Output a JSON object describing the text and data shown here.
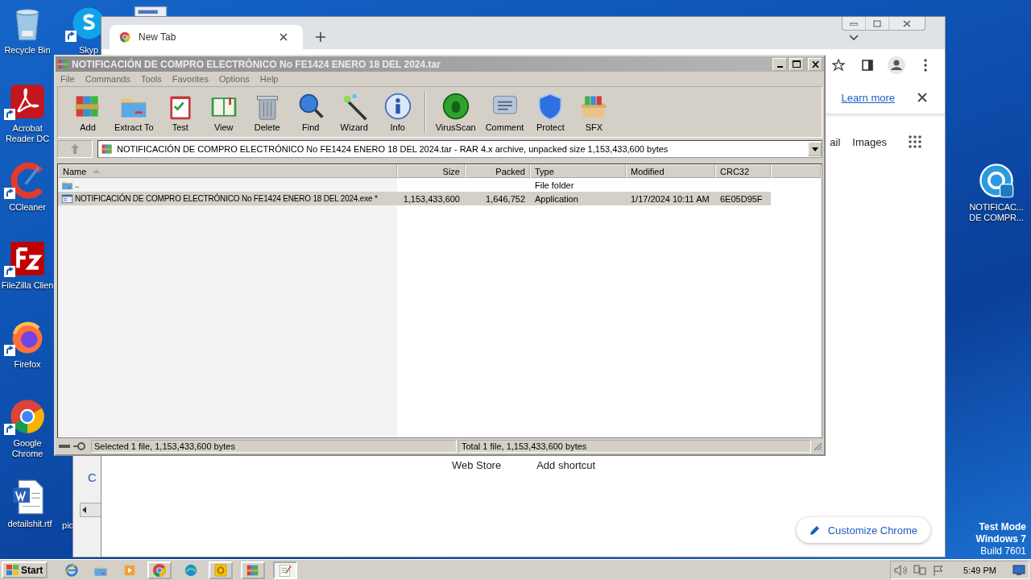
{
  "desktop": {
    "icons": [
      {
        "label": "Recycle Bin",
        "kind": "recycle",
        "shortcut": false
      },
      {
        "label": "Skyp",
        "kind": "skype",
        "shortcut": true
      },
      {
        "kind": "doc",
        "shortcut": false
      },
      {
        "label": "Acrobat Reader DC",
        "kind": "acrobat",
        "shortcut": true
      },
      {
        "label": "CCleaner",
        "kind": "ccleaner",
        "shortcut": true
      },
      {
        "label": "FileZilla Clien",
        "kind": "filezilla",
        "shortcut": true
      },
      {
        "label": "Firefox",
        "kind": "firefox",
        "shortcut": true
      },
      {
        "label": "Google Chrome",
        "kind": "chrome",
        "shortcut": true
      },
      {
        "label": "detailshit.rtf",
        "kind": "word",
        "shortcut": false
      },
      {
        "label": "pic",
        "shortcut": false
      },
      {
        "label": "NOTIFICAC... DE COMPR...",
        "kind": "app",
        "shortcut": false
      }
    ],
    "edition": [
      "Test Mode",
      "Windows 7",
      "Build 7601"
    ]
  },
  "back_window": {
    "text": "C"
  },
  "chrome": {
    "tab": {
      "title": "New Tab"
    },
    "banner": {
      "link": "Learn more"
    },
    "top_links": [
      "ail",
      "Images"
    ],
    "shortcuts": [
      "Web Store",
      "Add shortcut"
    ],
    "customize_button": "Customize Chrome"
  },
  "winrar": {
    "title": "NOTIFICACIÓN DE COMPRO ELECTRÓNICO No FE1424 ENERO 18 DEL 2024.tar",
    "menu": [
      "File",
      "Commands",
      "Tools",
      "Favorites",
      "Options",
      "Help"
    ],
    "toolbar": [
      {
        "label": "Add",
        "kind": "add",
        "separated": false
      },
      {
        "label": "Extract To",
        "kind": "extract",
        "separated": false
      },
      {
        "label": "Test",
        "kind": "test",
        "separated": false
      },
      {
        "label": "View",
        "kind": "view",
        "separated": false
      },
      {
        "label": "Delete",
        "kind": "delete",
        "separated": false
      },
      {
        "label": "Find",
        "kind": "find",
        "separated": false
      },
      {
        "label": "Wizard",
        "kind": "wizard",
        "separated": false
      },
      {
        "label": "Info",
        "kind": "info",
        "separated": false
      },
      {
        "label": "VirusScan",
        "kind": "virusscan",
        "separated": true
      },
      {
        "label": "Comment",
        "kind": "comment",
        "separated": false
      },
      {
        "label": "Protect",
        "kind": "protect",
        "separated": false
      },
      {
        "label": "SFX",
        "kind": "sfx",
        "separated": false
      }
    ],
    "address": "NOTIFICACIÓN DE COMPRO ELECTRÓNICO No FE1424 ENERO 18 DEL 2024.tar - RAR 4.x archive, unpacked size 1,153,433,600 bytes",
    "columns": [
      {
        "label": "Name",
        "sorted": true
      },
      {
        "label": "Size"
      },
      {
        "label": "Packed"
      },
      {
        "label": "Type"
      },
      {
        "label": "Modified"
      },
      {
        "label": "CRC32"
      }
    ],
    "rows": [
      {
        "kind": "folder",
        "selected": false,
        "cells": [
          "..",
          "",
          "",
          "File folder",
          "",
          ""
        ]
      },
      {
        "kind": "file",
        "selected": true,
        "cells": [
          "NOTIFICACIÓN DE COMPRO ELECTRÓNICO No FE1424 ENERO 18 DEL 2024.exe *",
          "1,153,433,600",
          "1,646,752",
          "Application",
          "1/17/2024 10:11 AM",
          "6E05D95F"
        ]
      }
    ],
    "status": [
      "Selected 1 file, 1,153,433,600 bytes",
      "Total 1 file, 1,153,433,600 bytes"
    ]
  },
  "taskbar": {
    "start": "Start",
    "items": [
      {
        "kind": "ie",
        "open": false,
        "active": false
      },
      {
        "kind": "explorer",
        "open": false,
        "active": false
      },
      {
        "kind": "media",
        "open": false,
        "active": false
      },
      {
        "kind": "chrome",
        "open": true,
        "active": false
      },
      {
        "kind": "edge",
        "open": false,
        "active": false
      },
      {
        "kind": "outlook",
        "open": true,
        "active": false
      },
      {
        "kind": "winrar",
        "open": true,
        "active": false
      },
      {
        "kind": "notepad",
        "open": true,
        "active": true
      }
    ],
    "clock": "5:49 PM"
  }
}
